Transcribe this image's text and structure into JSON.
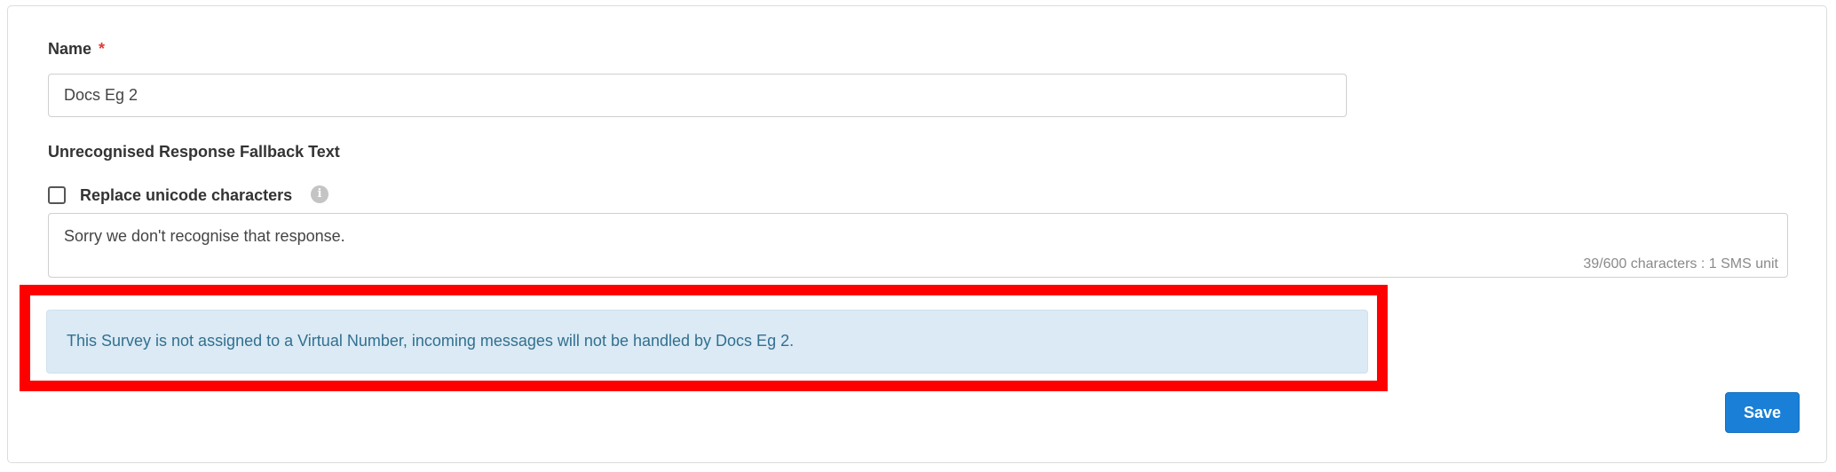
{
  "form": {
    "name_label": "Name",
    "required_marker": "*",
    "name_value": "Docs Eg 2",
    "fallback_label": "Unrecognised Response Fallback Text",
    "replace_unicode_label": "Replace unicode characters",
    "replace_unicode_checked": false,
    "info_icon": "i",
    "fallback_text": "Sorry we don't recognise that response.",
    "char_count": "39/600 characters : 1 SMS unit",
    "alert_text": "This Survey is not assigned to a Virtual Number, incoming messages will not be handled by Docs Eg 2.",
    "save_label": "Save"
  },
  "colors": {
    "primary": "#1a7fd6",
    "required": "#e53935",
    "alert_bg": "#dbeaf5",
    "alert_text": "#31708f",
    "highlight": "#ff0000"
  }
}
